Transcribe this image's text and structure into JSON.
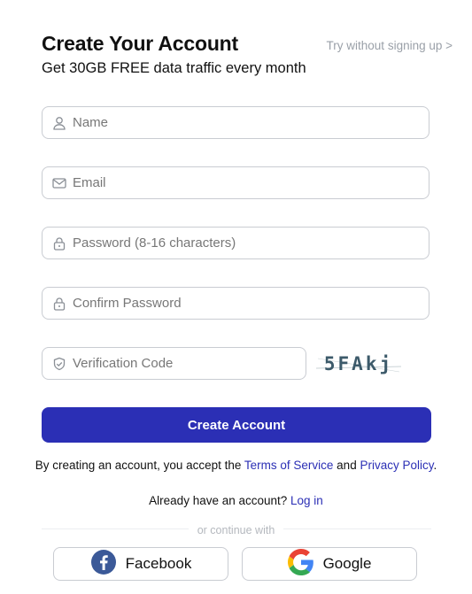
{
  "header": {
    "title": "Create Your Account",
    "subtitle": "Get 30GB FREE data traffic every month",
    "skip_link": "Try without signing up >"
  },
  "form": {
    "name_placeholder": "Name",
    "email_placeholder": "Email",
    "password_placeholder": "Password (8-16 characters)",
    "confirm_placeholder": "Confirm Password",
    "verification_placeholder": "Verification Code",
    "captcha_text": "5FAkj",
    "submit_label": "Create Account"
  },
  "terms": {
    "prefix": "By creating an account, you accept the ",
    "tos_link": "Terms of Service",
    "middle": " and ",
    "privacy_link": "Privacy Policy",
    "suffix": "."
  },
  "login": {
    "prompt": "Already have an account? ",
    "link": "Log in"
  },
  "divider": {
    "label": "or continue with"
  },
  "social": {
    "facebook_label": "Facebook",
    "google_label": "Google"
  },
  "colors": {
    "primary": "#2b2fb5",
    "facebook": "#3b5998"
  }
}
